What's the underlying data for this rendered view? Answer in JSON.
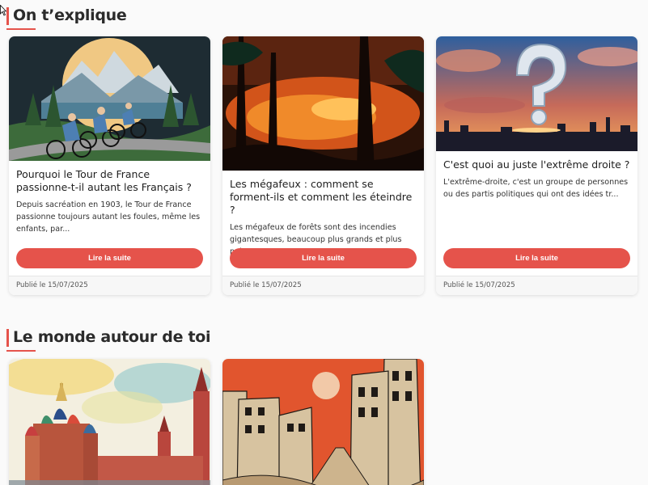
{
  "sections": [
    {
      "title": "On t’explique"
    },
    {
      "title": "Le monde autour de toi"
    }
  ],
  "cards": [
    {
      "title": "Pourquoi le Tour de France passionne-t-il autant les Français ?",
      "excerpt": "Depuis sacréation en 1903, le Tour de France passionne toujours autant les foules, même les enfants, par...",
      "button": "Lire la suite",
      "date": "Publié le 15/07/2025",
      "image": "cyclists-mountains-illustration"
    },
    {
      "title": "Les mégafeux : comment se forment-ils et comment les éteindre ?",
      "excerpt": "Les mégafeux de forêts sont des incendies gigantesques, beaucoup plus grands et plus puissants...",
      "button": "Lire la suite",
      "date": "Publié le 15/07/2025",
      "image": "forest-fire-illustration"
    },
    {
      "title": "C'est quoi au juste l'extrême droite ?",
      "excerpt": "L'extrême-droite, c'est un groupe de personnes ou des partis politiques qui ont des idées tr...",
      "button": "Lire la suite",
      "date": "Publié le 15/07/2025",
      "image": "cloud-question-mark-city"
    },
    {
      "image": "kremlin-watercolor"
    },
    {
      "image": "ruined-city-illustration"
    }
  ],
  "colors": {
    "accent": "#e5534b"
  }
}
